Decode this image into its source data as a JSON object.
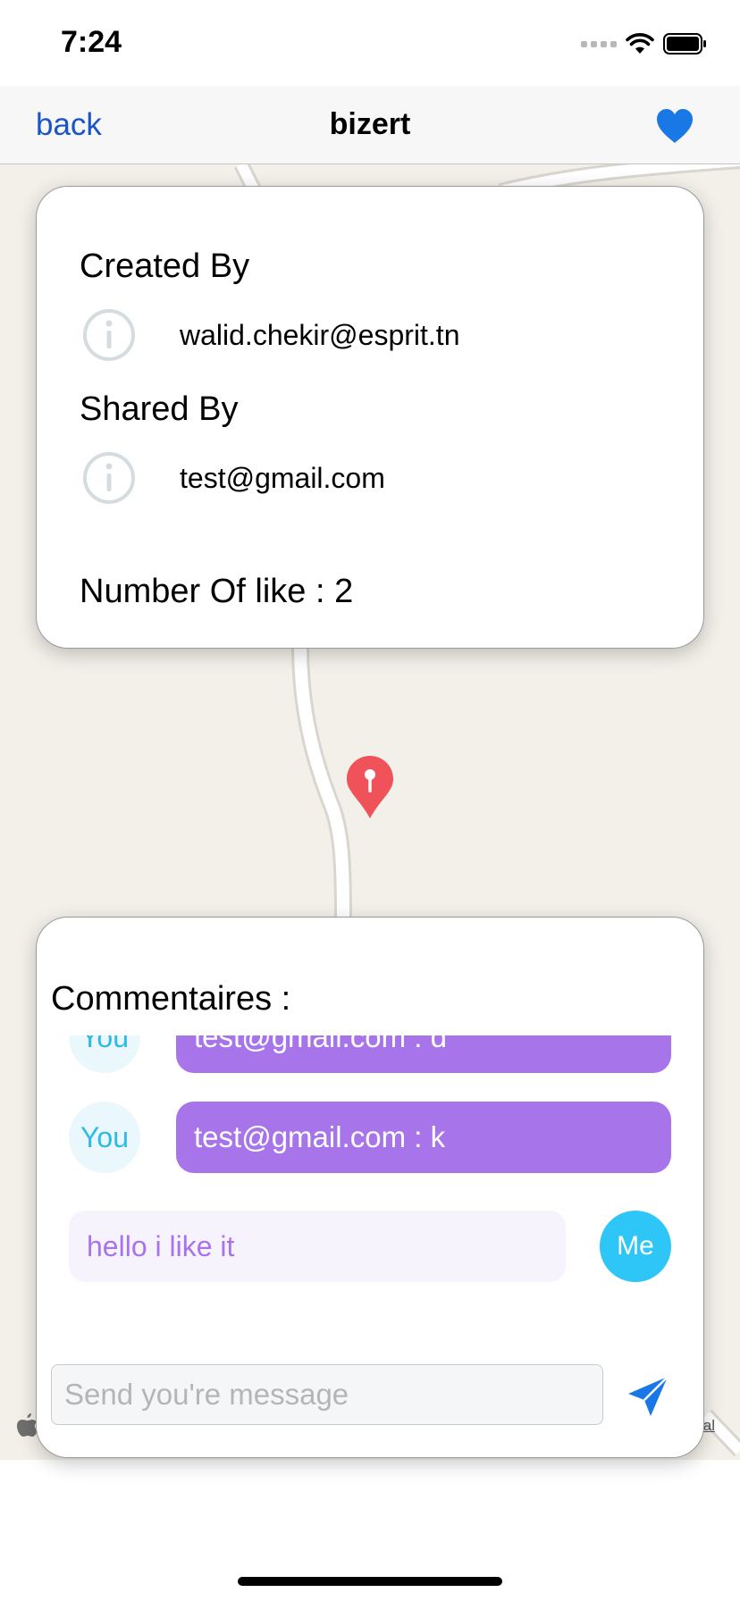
{
  "status_bar": {
    "time": "7:24"
  },
  "nav": {
    "back_label": "back",
    "title": "bizert",
    "favorite_icon": "heart-icon"
  },
  "info_card": {
    "created_by_label": "Created By",
    "created_by_value": "walid.chekir@esprit.tn",
    "shared_by_label": "Shared By",
    "shared_by_value": "test@gmail.com",
    "likes_text": "Number Of like : 2",
    "row_icon": "info-circle-icon"
  },
  "comments": {
    "title": "Commentaires :",
    "messages": [
      {
        "avatar": "You",
        "text": "test@gmail.com : d"
      },
      {
        "avatar": "You",
        "text": "test@gmail.com : k"
      }
    ],
    "my_message": {
      "text": "hello i like it",
      "avatar": "Me"
    },
    "input_placeholder": "Send you're message",
    "send_icon": "paper-plane-icon"
  },
  "map": {
    "legal_text": "Legal",
    "pin_icon": "map-pin-icon"
  },
  "colors": {
    "accent": "#1a55c6",
    "heart": "#1a78e6",
    "bubble_other": "#a874ea",
    "bubble_me_bg": "#f6f3fd",
    "avatar_me": "#2ec6f7",
    "pin": "#f0525a"
  }
}
